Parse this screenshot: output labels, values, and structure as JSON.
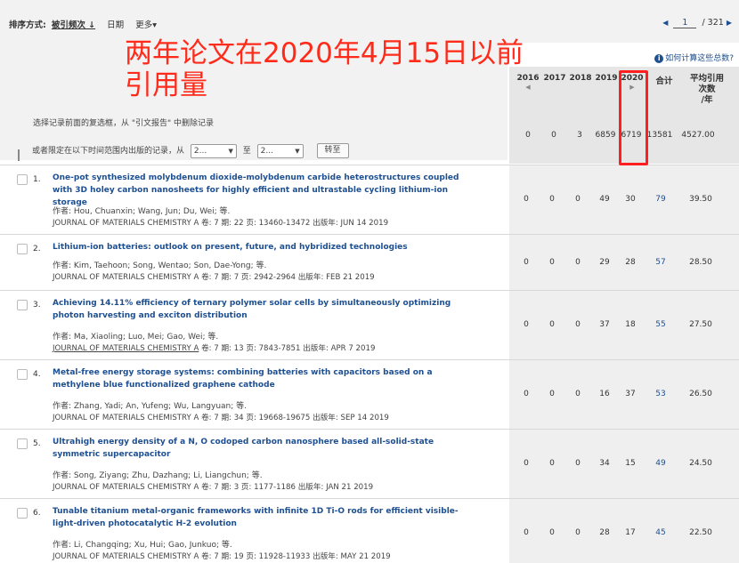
{
  "sort": {
    "label": "排序方式:",
    "selected": "被引频次 ↓",
    "option_date": "日期",
    "option_more": "更多▾"
  },
  "pager": {
    "prev": "◀",
    "page": "1",
    "total": "/ 321",
    "next": "▶"
  },
  "help_link": "如何计算这些总数?",
  "annotation": {
    "line1": "两年论文在2020年4月15日以前",
    "line2": "引用量"
  },
  "hint": "选择记录前面的复选框，从 \"引文报告\" 中删除记录",
  "limit": {
    "label": "或者限定在以下时间范围内出版的记录，从",
    "from": "2...",
    "to_label": "至",
    "to": "2...",
    "go": "转至"
  },
  "headers": {
    "years": [
      "2016",
      "2017",
      "2018",
      "2019",
      "2020"
    ],
    "total": "合计",
    "avg": "平均引用次数/年",
    "avg_l1": "平均引用",
    "avg_l2": "次数",
    "avg_l3": "/年"
  },
  "totals": {
    "values": [
      "0",
      "0",
      "3",
      "6859",
      "6719"
    ],
    "total": "13581",
    "avg": "4527.00"
  },
  "colors": {
    "link": "#1d4f91",
    "annotation": "#ff2b1a",
    "highlight_box": "#ff1f1f"
  },
  "records": [
    {
      "num": "1.",
      "title": "One-pot synthesized molybdenum dioxide-molybdenum carbide heterostructures coupled with 3D holey carbon nanosheets for highly efficient and ultrastable cycling lithium-ion storage",
      "authors": "作者: Hou, Chuanxin; Wang, Jun; Du, Wei; 等.",
      "journal": "JOURNAL OF MATERIALS CHEMISTRY A",
      "details": "卷: 7  期: 22  页: 13460-13472  出版年: JUN 14 2019",
      "c2016": "0",
      "c2017": "0",
      "c2018": "0",
      "c2019": "49",
      "c2020": "30",
      "total": "79",
      "avg": "39.50"
    },
    {
      "num": "2.",
      "title": "Lithium-ion batteries: outlook on present, future, and hybridized technologies",
      "authors": "作者: Kim, Taehoon; Song, Wentao; Son, Dae-Yong; 等.",
      "journal": "JOURNAL OF MATERIALS CHEMISTRY A",
      "details": "卷: 7  期: 7  页: 2942-2964  出版年: FEB 21 2019",
      "c2016": "0",
      "c2017": "0",
      "c2018": "0",
      "c2019": "29",
      "c2020": "28",
      "total": "57",
      "avg": "28.50"
    },
    {
      "num": "3.",
      "title": "Achieving 14.11% efficiency of ternary polymer solar cells by simultaneously optimizing photon harvesting and exciton distribution",
      "authors": "作者: Ma, Xiaoling; Luo, Mei; Gao, Wei; 等.",
      "journal": "JOURNAL OF MATERIALS CHEMISTRY A",
      "details": "卷: 7  期: 13  页: 7843-7851  出版年: APR 7 2019",
      "c2016": "0",
      "c2017": "0",
      "c2018": "0",
      "c2019": "37",
      "c2020": "18",
      "total": "55",
      "avg": "27.50"
    },
    {
      "num": "4.",
      "title": "Metal-free energy storage systems: combining batteries with capacitors based on a methylene blue functionalized graphene cathode",
      "authors": "作者: Zhang, Yadi; An, Yufeng; Wu, Langyuan; 等.",
      "journal": "JOURNAL OF MATERIALS CHEMISTRY A",
      "details": "卷: 7  期: 34  页: 19668-19675  出版年: SEP 14 2019",
      "c2016": "0",
      "c2017": "0",
      "c2018": "0",
      "c2019": "16",
      "c2020": "37",
      "total": "53",
      "avg": "26.50"
    },
    {
      "num": "5.",
      "title": "Ultrahigh energy density of a N, O codoped carbon nanosphere based all-solid-state symmetric supercapacitor",
      "authors": "作者: Song, Ziyang; Zhu, Dazhang; Li, Liangchun; 等.",
      "journal": "JOURNAL OF MATERIALS CHEMISTRY A",
      "details": "卷: 7  期: 3  页: 1177-1186  出版年: JAN 21 2019",
      "c2016": "0",
      "c2017": "0",
      "c2018": "0",
      "c2019": "34",
      "c2020": "15",
      "total": "49",
      "avg": "24.50"
    },
    {
      "num": "6.",
      "title": "Tunable titanium metal-organic frameworks with infinite 1D Ti-O rods for efficient visible-light-driven photocatalytic H-2 evolution",
      "authors": "作者: Li, Changqing; Xu, Hui; Gao, Junkuo; 等.",
      "journal": "JOURNAL OF MATERIALS CHEMISTRY A",
      "details": "卷: 7  期: 19  页: 11928-11933  出版年: MAY 21 2019",
      "c2016": "0",
      "c2017": "0",
      "c2018": "0",
      "c2019": "28",
      "c2020": "17",
      "total": "45",
      "avg": "22.50"
    }
  ]
}
